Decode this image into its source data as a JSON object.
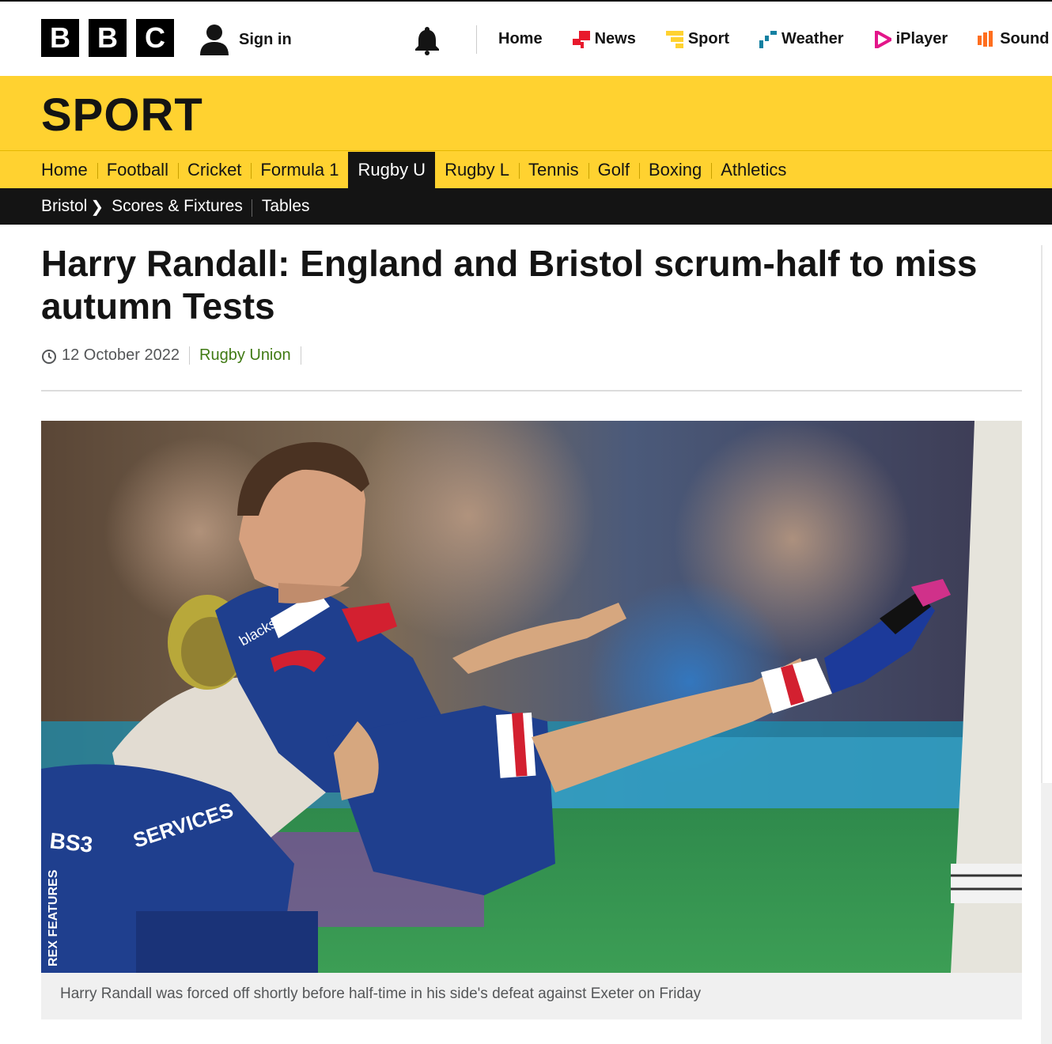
{
  "brand": {
    "letters": [
      "B",
      "B",
      "C"
    ]
  },
  "account": {
    "signin_label": "Sign in"
  },
  "topnav": [
    {
      "label": "Home",
      "icon": ""
    },
    {
      "label": "News",
      "icon": "news-icon",
      "color": "#e8192c"
    },
    {
      "label": "Sport",
      "icon": "sport-icon",
      "color": "#ffd230"
    },
    {
      "label": "Weather",
      "icon": "weather-icon",
      "color": "#1380a1"
    },
    {
      "label": "iPlayer",
      "icon": "iplayer-icon",
      "color": "#e3168a"
    },
    {
      "label": "Sound",
      "icon": "sounds-icon",
      "color": "#ff6e1e"
    }
  ],
  "section": {
    "title": "SPORT"
  },
  "sportnav": [
    {
      "label": "Home",
      "active": false
    },
    {
      "label": "Football",
      "active": false
    },
    {
      "label": "Cricket",
      "active": false
    },
    {
      "label": "Formula 1",
      "active": false
    },
    {
      "label": "Rugby U",
      "active": true
    },
    {
      "label": "Rugby L",
      "active": false
    },
    {
      "label": "Tennis",
      "active": false
    },
    {
      "label": "Golf",
      "active": false
    },
    {
      "label": "Boxing",
      "active": false
    },
    {
      "label": "Athletics",
      "active": false
    }
  ],
  "subnav": {
    "team": "Bristol",
    "links": [
      "Scores & Fixtures",
      "Tables"
    ]
  },
  "article": {
    "headline": "Harry Randall: England and Bristol scrum-half to miss autumn Tests",
    "date": "12 October 2022",
    "topic": "Rugby Union",
    "image_credit": "REX FEATURES",
    "jersey_texts": [
      "blackstar",
      "BS3",
      "SERVICES"
    ],
    "caption": "Harry Randall was forced off shortly before half-time in his side's defeat against Exeter on Friday"
  },
  "colors": {
    "sport_yellow": "#ffd230",
    "topic_green": "#407a14",
    "nav_dark": "#141414"
  }
}
